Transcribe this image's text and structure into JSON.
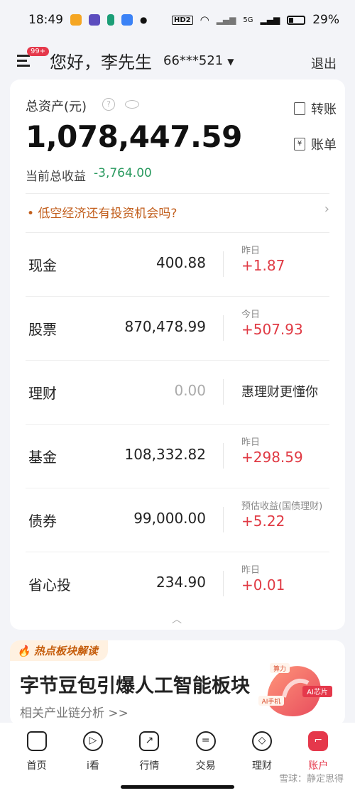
{
  "status_bar": {
    "time": "18:49",
    "signal": "5G",
    "battery": "29%",
    "hd": "HD2",
    "colors": {
      "app1": "#f5a623",
      "app2": "#5c4dbe",
      "app3": "#1b9e77",
      "app4": "#3b82f6"
    }
  },
  "header": {
    "menu_badge": "99+",
    "greeting": "您好，李先生",
    "account": "66***521",
    "logout": "退出"
  },
  "assets": {
    "total_label": "总资产(元)",
    "total_value": "1,078,447.59",
    "transfer": "转账",
    "bill": "账单",
    "profit_label": "当前总收益",
    "profit_value": "-3,764.00",
    "tip": "低空经济还有投资机会吗?"
  },
  "rows": [
    {
      "name": "现金",
      "value": "400.88",
      "sub": "昨日",
      "change": "+1.87"
    },
    {
      "name": "股票",
      "value": "870,478.99",
      "sub": "今日",
      "change": "+507.93"
    },
    {
      "name": "理财",
      "value": "0.00",
      "promo": "惠理财更懂你"
    },
    {
      "name": "基金",
      "value": "108,332.82",
      "sub": "昨日",
      "change": "+298.59"
    },
    {
      "name": "债券",
      "value": "99,000.00",
      "sub": "预估收益(国债理财)",
      "change": "+5.22"
    },
    {
      "name": "省心投",
      "value": "234.90",
      "sub": "昨日",
      "change": "+0.01"
    }
  ],
  "hot": {
    "tag": "热点板块解读",
    "title": "字节豆包引爆人工智能板块",
    "link": "相关产业链分析 >>",
    "art_labels": [
      "算力",
      "AI手机",
      "AI芯片"
    ]
  },
  "tabs": [
    {
      "label": "首页",
      "icon": "home-icon"
    },
    {
      "label": "i看",
      "icon": "play-icon"
    },
    {
      "label": "行情",
      "icon": "chart-icon"
    },
    {
      "label": "交易",
      "icon": "trade-icon"
    },
    {
      "label": "理财",
      "icon": "wealth-icon"
    },
    {
      "label": "账户",
      "icon": "account-icon"
    }
  ],
  "watermark": "雪球：静定思得"
}
